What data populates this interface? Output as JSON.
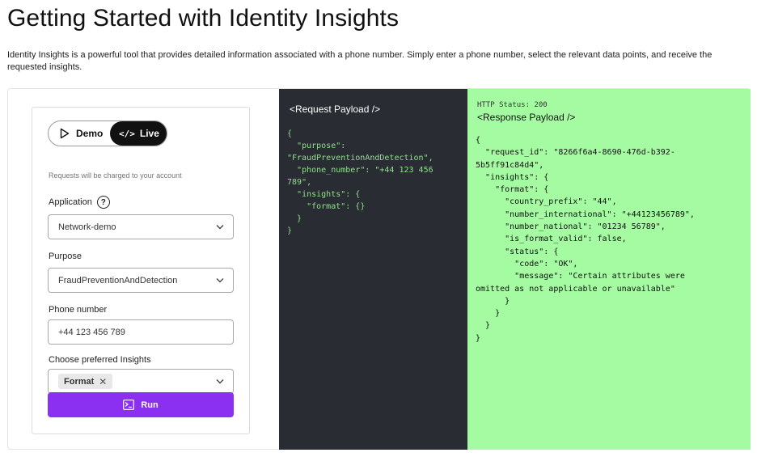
{
  "header": {
    "title": "Getting Started with Identity Insights",
    "description": "Identity Insights is a powerful tool that provides detailed information associated with a phone number. Simply enter a phone number, select the relevant data points, and receive the requested insights."
  },
  "form": {
    "mode_toggle": {
      "demo_label": "Demo",
      "live_label": "Live",
      "selected": "Live"
    },
    "charge_note": "Requests will be charged to your account",
    "application": {
      "label": "Application",
      "value": "Network-demo"
    },
    "purpose": {
      "label": "Purpose",
      "value": "FraudPreventionAndDetection"
    },
    "phone": {
      "label": "Phone number",
      "value": "+44 123 456 789"
    },
    "insights": {
      "label": "Choose preferred Insights",
      "chips": [
        "Format"
      ]
    },
    "run_label": "Run"
  },
  "request": {
    "title": "<Request Payload />",
    "code": "{\n  \"purpose\":\n\"FraudPreventionAndDetection\",\n  \"phone_number\": \"+44 123 456\n789\",\n  \"insights\": {\n    \"format\": {}\n  }\n}"
  },
  "response": {
    "status": "HTTP Status: 200",
    "title": "<Response Payload />",
    "code": "{\n  \"request_id\": \"8266f6a4-8690-476d-b392-\n5b5ff91c84d4\",\n  \"insights\": {\n    \"format\": {\n      \"country_prefix\": \"44\",\n      \"number_international\": \"+44123456789\",\n      \"number_national\": \"01234 56789\",\n      \"is_format_valid\": false,\n      \"status\": {\n        \"code\": \"OK\",\n        \"message\": \"Certain attributes were\nomitted as not applicable or unavailable\"\n      }\n    }\n  }\n}"
  },
  "colors": {
    "run_button": "#8b2ff0",
    "request_panel_bg": "#2a2c33",
    "request_code_text": "#8ee08a",
    "response_panel_bg": "#a5fba2"
  },
  "icons": {
    "demo": "play-icon",
    "live": "code-icon",
    "help": "help-circle-icon",
    "dropdown": "chevron-down-icon",
    "chip_remove": "close-icon",
    "run": "terminal-icon"
  }
}
